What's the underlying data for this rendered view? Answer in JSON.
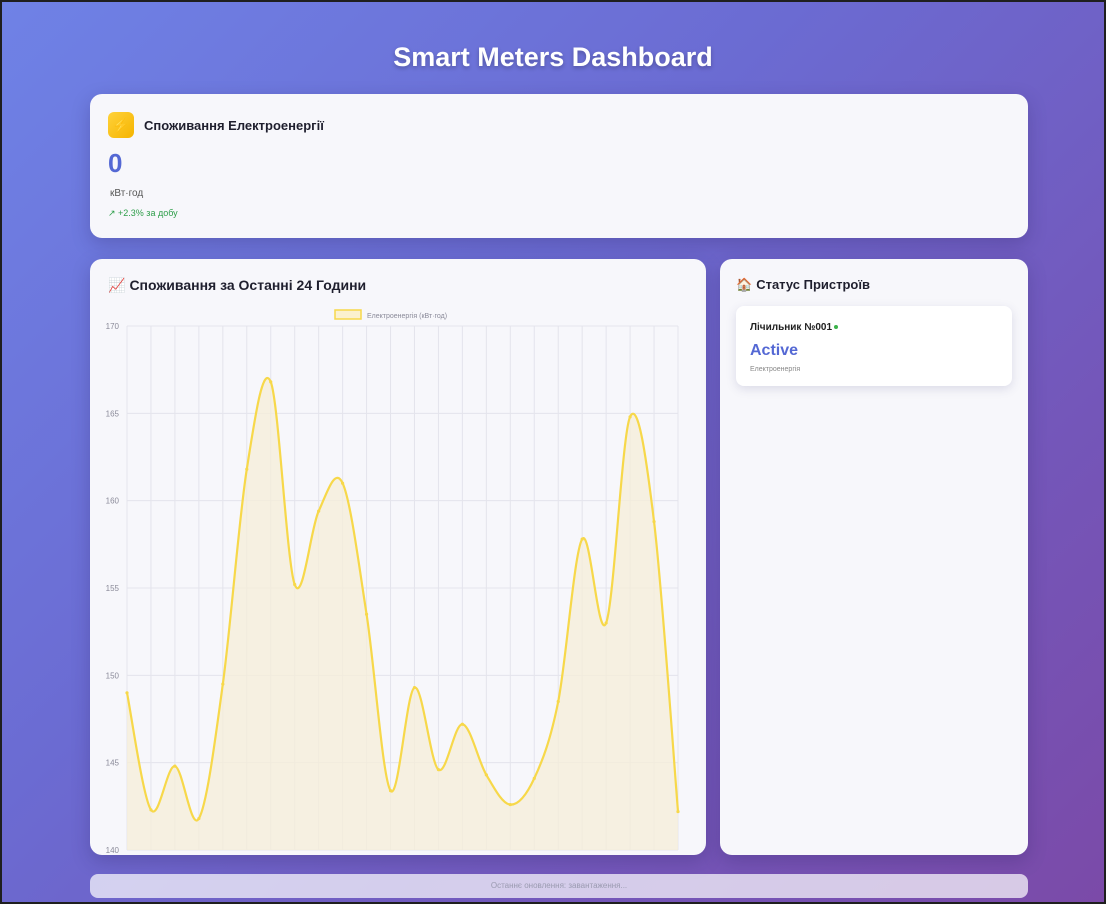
{
  "page": {
    "title": "Smart Meters Dashboard"
  },
  "consumption": {
    "icon": "bolt-icon",
    "title": "Споживання Електроенергії",
    "value": "0",
    "unit": "кВт·год",
    "trend": "↗ +2.3% за добу"
  },
  "chart_panel": {
    "icon": "chart-icon",
    "title": "Споживання за Останні 24 Години"
  },
  "status_panel": {
    "icon": "house-icon",
    "title": "Статус Пристроїв",
    "device": {
      "name": "Лічильник №001",
      "status": "Active",
      "type": "Електроенергія"
    }
  },
  "footer": {
    "text": "Останнє оновлення: завантаження..."
  },
  "colors": {
    "accent": "#5468d4",
    "line": "#f7d84a",
    "fill": "#f6eed8"
  },
  "chart_data": {
    "type": "line",
    "title": "",
    "legend": "Електроенергія (кВт·год)",
    "legend_position": "top",
    "xlabel": "",
    "ylabel": "",
    "ylim": [
      140,
      170
    ],
    "yticks": [
      140,
      145,
      150,
      155,
      160,
      165,
      170
    ],
    "grid": true,
    "series": [
      {
        "name": "Електроенергія (кВт·год)",
        "values": [
          149,
          142.3,
          144.8,
          141.8,
          149.5,
          161.8,
          166.8,
          155.2,
          159.4,
          161,
          153.5,
          143.4,
          149.3,
          144.6,
          147.2,
          144.3,
          142.6,
          144.1,
          148.5,
          157.8,
          153.0,
          164.8,
          158.8,
          142.2
        ]
      }
    ]
  }
}
